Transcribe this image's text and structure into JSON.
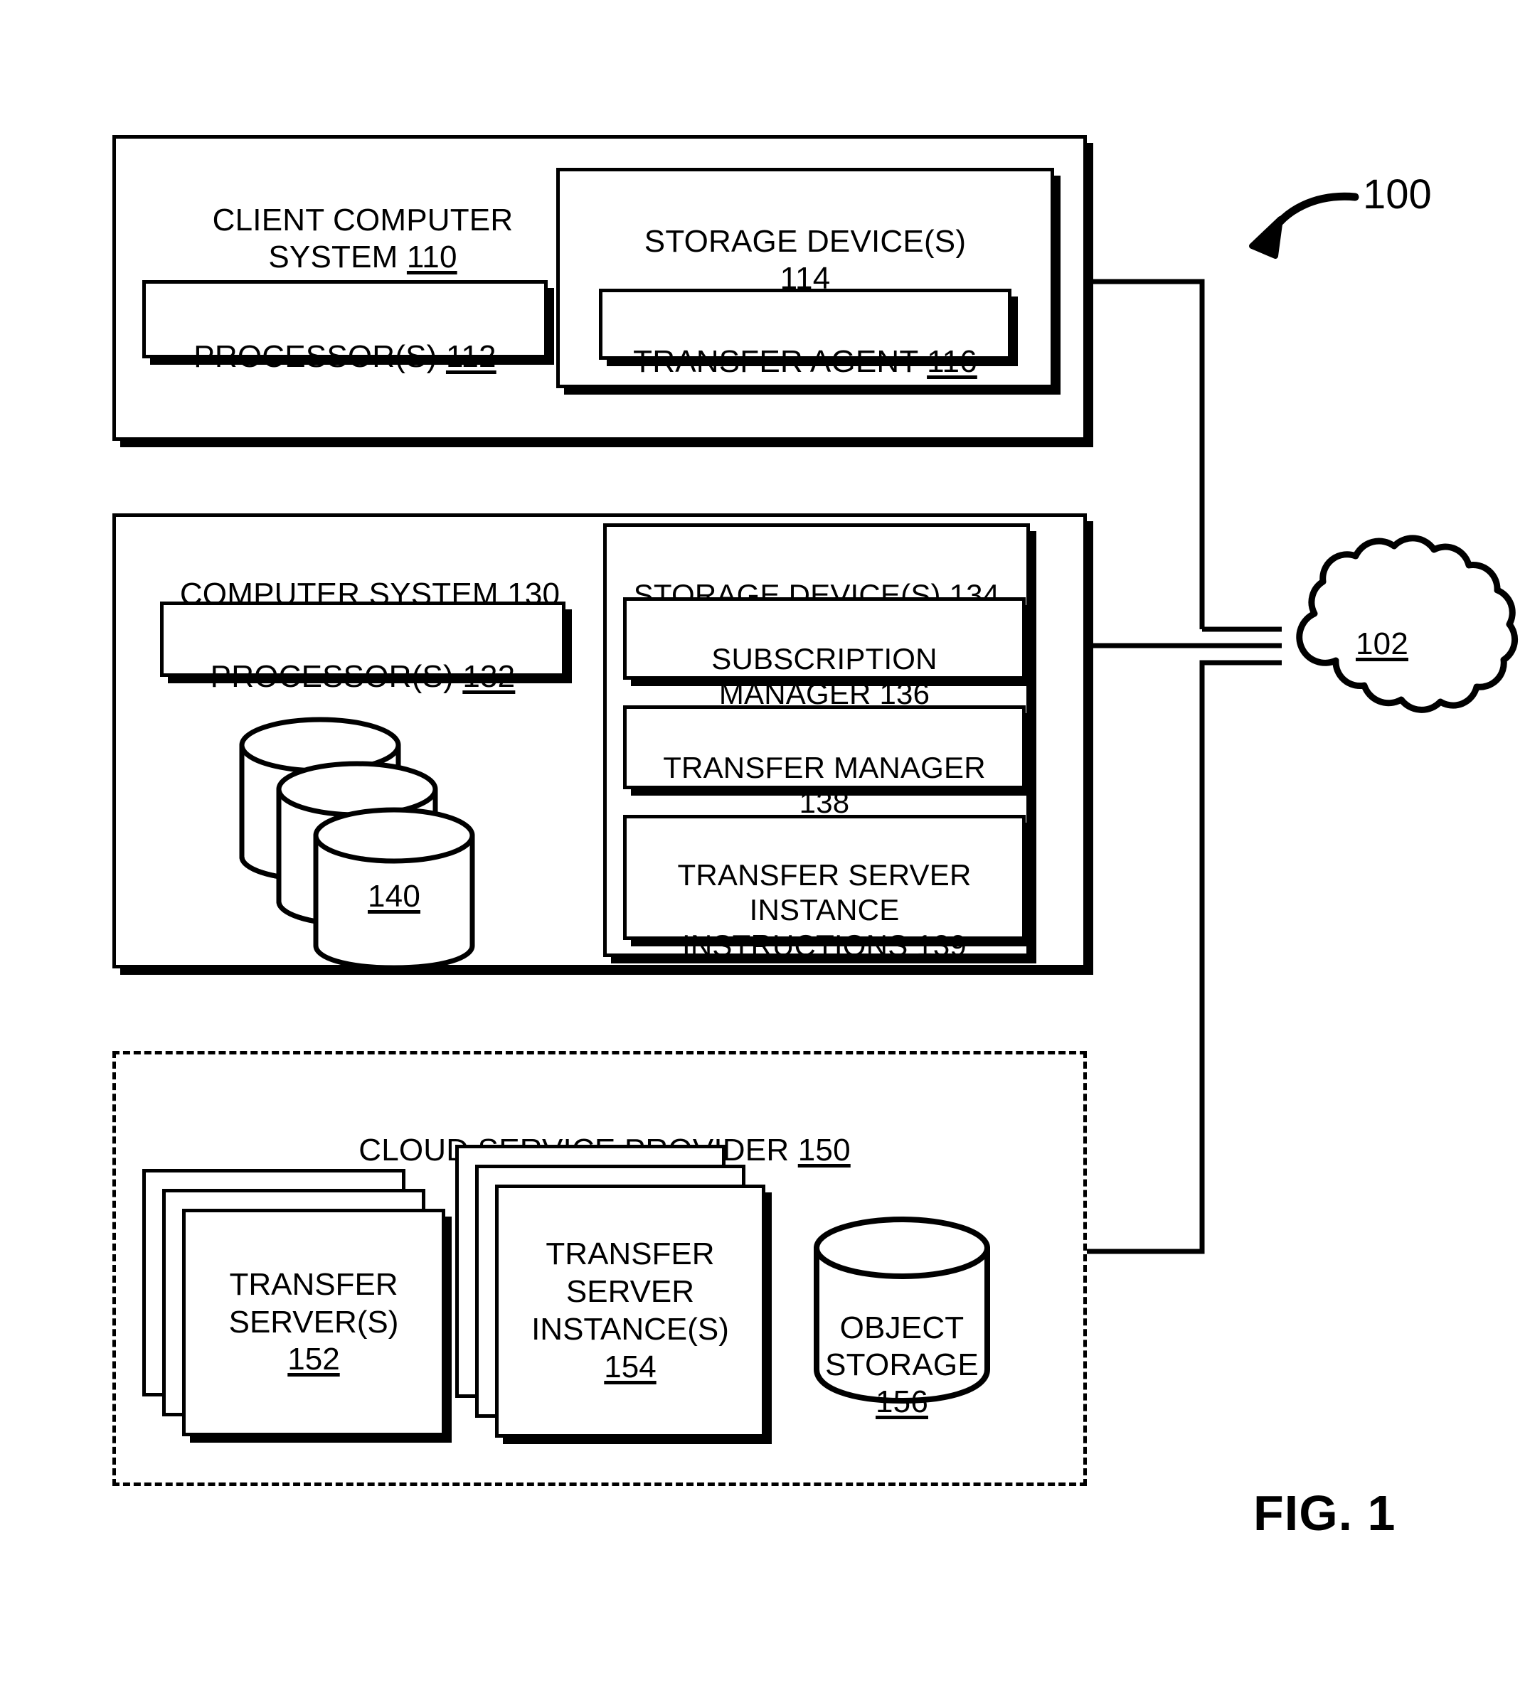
{
  "figure": {
    "caption": "FIG. 1",
    "system_ref": "100",
    "network_ref": "102"
  },
  "client_system": {
    "title": "CLIENT COMPUTER\nSYSTEM ",
    "ref": "110",
    "processor": {
      "label": "PROCESSOR(S) ",
      "ref": "112"
    },
    "storage": {
      "label": "STORAGE DEVICE(S)\n",
      "ref": "114",
      "children": [
        {
          "label": "TRANSFER AGENT ",
          "ref": "116"
        }
      ]
    }
  },
  "computer_system": {
    "title": "COMPUTER SYSTEM ",
    "ref": "130",
    "processor": {
      "label": "PROCESSOR(S) ",
      "ref": "132"
    },
    "databases": {
      "ref": "140",
      "count": 3
    },
    "storage": {
      "label": "STORAGE DEVICE(S) ",
      "ref": "134",
      "children": [
        {
          "label": "SUBSCRIPTION\nMANAGER ",
          "ref": "136"
        },
        {
          "label": "TRANSFER MANAGER\n",
          "ref": "138"
        },
        {
          "label": "TRANSFER SERVER\nINSTANCE\nINSTRUCTIONS ",
          "ref": "139"
        }
      ]
    }
  },
  "cloud_service_provider": {
    "title": "CLOUD SERVICE PROVIDER ",
    "ref": "150",
    "items": [
      {
        "label": "TRANSFER\nSERVER(S)\n",
        "ref": "152",
        "shape": "stacked-card"
      },
      {
        "label": "TRANSFER\nSERVER\nINSTANCE(S)\n",
        "ref": "154",
        "shape": "stacked-card"
      },
      {
        "label": "OBJECT\nSTORAGE\n",
        "ref": "156",
        "shape": "cylinder"
      }
    ]
  },
  "colors": {
    "stroke": "#000000",
    "background": "#ffffff"
  }
}
